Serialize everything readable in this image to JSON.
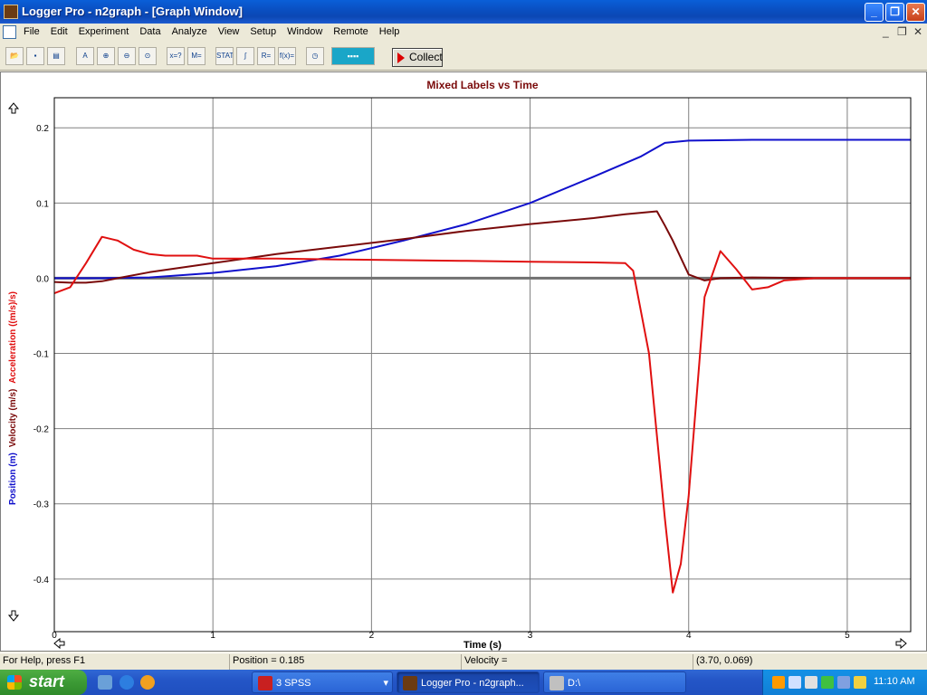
{
  "window": {
    "title": "Logger Pro - n2graph - [Graph Window]"
  },
  "caption_buttons": {
    "minimize": "_",
    "restore": "❐",
    "close": "✕"
  },
  "menu": {
    "items": [
      "File",
      "Edit",
      "Experiment",
      "Data",
      "Analyze",
      "View",
      "Setup",
      "Window",
      "Remote",
      "Help"
    ]
  },
  "mdi_controls": {
    "minimize": "_",
    "restore": "❐",
    "close": "✕"
  },
  "toolbar": {
    "buttons": [
      {
        "name": "open-icon",
        "glyph": "📂"
      },
      {
        "name": "save-icon",
        "glyph": "▪"
      },
      {
        "name": "print-icon",
        "glyph": "▤"
      },
      {
        "name": "autoscale-icon",
        "glyph": "A"
      },
      {
        "name": "zoom-in-icon",
        "glyph": "⊕"
      },
      {
        "name": "zoom-out-icon",
        "glyph": "⊖"
      },
      {
        "name": "zoom-icon",
        "glyph": "⊙"
      },
      {
        "name": "examine-icon",
        "glyph": "x=?"
      },
      {
        "name": "tangent-icon",
        "glyph": "M="
      },
      {
        "name": "statistics-icon",
        "glyph": "STAT"
      },
      {
        "name": "integral-icon",
        "glyph": "∫"
      },
      {
        "name": "linear-fit-icon",
        "glyph": "R="
      },
      {
        "name": "curve-fit-icon",
        "glyph": "f(x)="
      },
      {
        "name": "timer-icon",
        "glyph": "◷"
      },
      {
        "name": "sensor-interface-icon",
        "glyph": "▪▪▪▪"
      }
    ],
    "collect_label": "Collect"
  },
  "chart_data": {
    "type": "line",
    "title": "Mixed Labels vs Time",
    "xlabel": "Time (s)",
    "ylabel_parts": [
      "Position (m)",
      "Velocity (m/s)",
      "Acceleration ((m/s)/s)"
    ],
    "xlim": [
      0,
      5.4
    ],
    "ylim": [
      -0.47,
      0.24
    ],
    "xticks": [
      0,
      1,
      2,
      3,
      4,
      5
    ],
    "yticks": [
      0.2,
      0.1,
      0.0,
      -0.1,
      -0.2,
      -0.3,
      -0.4
    ],
    "ytick_labels": [
      "0.2",
      "0.1",
      "0.0",
      "-0.1",
      "-0.2",
      "-0.3",
      "-0.4"
    ],
    "grid": true,
    "series": [
      {
        "name": "Position (m)",
        "color": "#1010cc",
        "x": [
          0,
          0.3,
          0.6,
          1.0,
          1.4,
          1.8,
          2.2,
          2.6,
          3.0,
          3.4,
          3.7,
          3.85,
          4.0,
          4.4,
          4.8,
          5.4
        ],
        "y": [
          0.0,
          0.0,
          0.001,
          0.007,
          0.016,
          0.03,
          0.05,
          0.072,
          0.1,
          0.135,
          0.162,
          0.18,
          0.183,
          0.184,
          0.184,
          0.184
        ]
      },
      {
        "name": "Velocity (m/s)",
        "color": "#7a0a0a",
        "x": [
          0,
          0.1,
          0.2,
          0.3,
          0.4,
          0.6,
          0.8,
          1.0,
          1.4,
          1.8,
          2.2,
          2.6,
          3.0,
          3.4,
          3.6,
          3.8,
          3.85,
          3.9,
          4.0,
          4.1,
          4.2,
          4.4,
          4.8,
          5.4
        ],
        "y": [
          -0.005,
          -0.006,
          -0.006,
          -0.004,
          0.0,
          0.008,
          0.014,
          0.02,
          0.032,
          0.042,
          0.052,
          0.063,
          0.072,
          0.08,
          0.085,
          0.089,
          0.07,
          0.05,
          0.005,
          -0.003,
          0.0,
          0.001,
          0.0,
          0.0
        ]
      },
      {
        "name": "Acceleration ((m/s)/s)",
        "color": "#e01010",
        "x": [
          0,
          0.1,
          0.2,
          0.3,
          0.4,
          0.5,
          0.6,
          0.7,
          0.8,
          0.9,
          1.0,
          1.4,
          1.8,
          2.2,
          2.6,
          3.0,
          3.4,
          3.6,
          3.65,
          3.75,
          3.85,
          3.9,
          3.95,
          4.0,
          4.1,
          4.2,
          4.3,
          4.4,
          4.5,
          4.6,
          4.8,
          5.4
        ],
        "y": [
          -0.02,
          -0.012,
          0.02,
          0.055,
          0.05,
          0.038,
          0.032,
          0.03,
          0.03,
          0.03,
          0.026,
          0.026,
          0.025,
          0.024,
          0.023,
          0.022,
          0.021,
          0.02,
          0.01,
          -0.1,
          -0.32,
          -0.418,
          -0.38,
          -0.29,
          -0.025,
          0.036,
          0.012,
          -0.015,
          -0.012,
          -0.003,
          0.0,
          0.0
        ]
      }
    ]
  },
  "statusbar": {
    "help": "For Help, press F1",
    "position": "Position = 0.185",
    "velocity": "Velocity =",
    "coords": "(3.70, 0.069)"
  },
  "taskbar": {
    "start_label": "start",
    "tasks": [
      {
        "label": "3 SPSS",
        "active": false
      },
      {
        "label": "Logger Pro - n2graph...",
        "active": true
      },
      {
        "label": "D:\\",
        "active": false
      }
    ],
    "clock": "11:10 AM"
  }
}
